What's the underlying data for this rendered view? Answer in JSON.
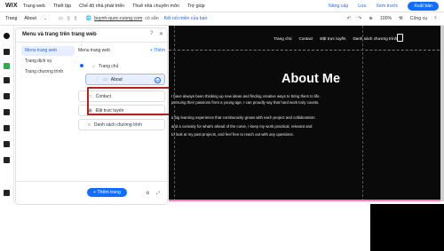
{
  "app": {
    "logo": "WIX",
    "menu": [
      "Trang web",
      "Thiết lập",
      "Chế độ nhà phát triển",
      "Thuê nhà chuyên môn",
      "Trợ giúp"
    ],
    "upgrade": "Nâng cấp",
    "save": "Lưu",
    "preview": "Xem trước",
    "publish": "Xuất bản"
  },
  "toolbar": {
    "page_label": "Trang",
    "page_value": "About",
    "url": "buynh-quoc-cuong.com",
    "url_suffix": "có sẵn",
    "connect": "Kết nối miền của bạn",
    "zoom": "100%",
    "tools": "Công cụ"
  },
  "panel": {
    "title": "Menu và trang trên trang web",
    "nav": [
      "Menu trang web",
      "Trang dịch vụ",
      "Trang chương trình"
    ],
    "menu_header": "Menu trang web",
    "add_label": "Thêm",
    "items": {
      "home": "Trang chủ",
      "about": "About",
      "contact": "Contact",
      "services": "Đặt trực tuyến",
      "programs": "Danh sách chương trình"
    },
    "add_page": "Thêm trang"
  },
  "site": {
    "nav": [
      "Trang chủ",
      "Contact",
      "Đặt trực tuyến",
      "Danh sách chương trình"
    ],
    "hero": "About Me",
    "paragraphs": [
      "I have always been thinking up new ideas and finding creative ways to bring them to life.",
      "pursuing their passions from a young age, I can proudly say that hard work truly counts.",
      "a big learning experience that continuously grows with each project and collaboration.",
      "and a curiosity for what's ahead of the curve, I keep my work practical, relevant and",
      "to look at my past projects, and feel free to reach out with any questions."
    ]
  }
}
